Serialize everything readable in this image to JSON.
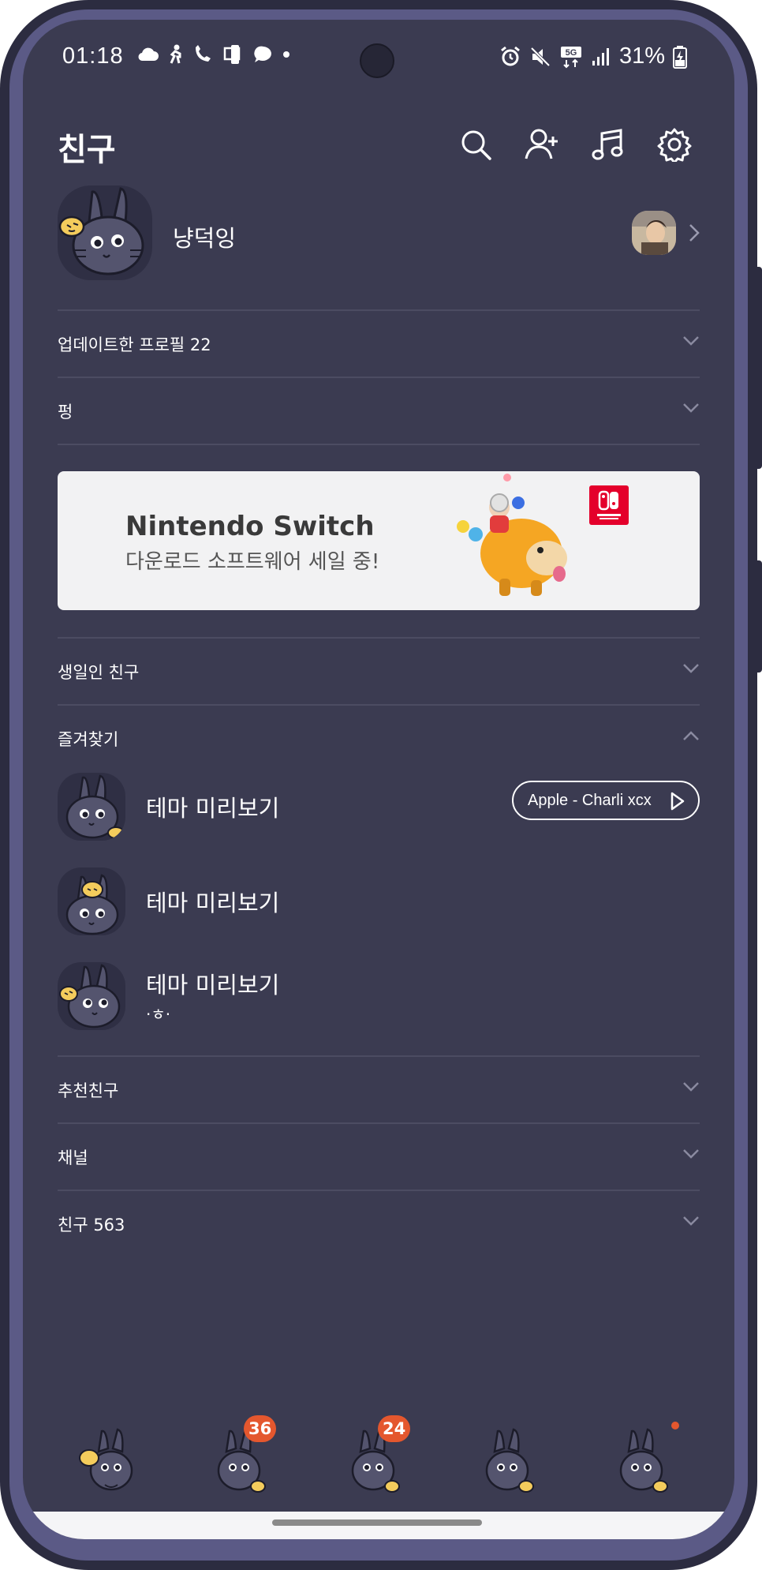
{
  "status_bar": {
    "time": "01:18",
    "battery": "31%",
    "network": "5G"
  },
  "header": {
    "title": "친구",
    "icons": [
      "search-icon",
      "add-friend-icon",
      "music-icon",
      "settings-icon"
    ]
  },
  "profile": {
    "name": "냥덕잉"
  },
  "sections": {
    "updated_profiles": "업데이트한 프로필 22",
    "pyeong": "펑",
    "birthday": "생일인 친구",
    "favorites": "즐겨찾기",
    "recommended": "추천친구",
    "channels": "채널",
    "friends": "친구 563"
  },
  "banner": {
    "title": "Nintendo Switch",
    "subtitle": "다운로드 소프트웨어 세일 중!"
  },
  "favorites": [
    {
      "name": "테마 미리보기",
      "music": "Apple - Charli xcx"
    },
    {
      "name": "테마 미리보기"
    },
    {
      "name": "테마 미리보기",
      "status": "·ㅎ·"
    }
  ],
  "tabbar": {
    "badges": [
      "36",
      "24"
    ]
  },
  "colors": {
    "background": "#3b3b51",
    "frame": "#5b5a86",
    "badge": "#e4572e",
    "divider": "#4c4c62"
  }
}
